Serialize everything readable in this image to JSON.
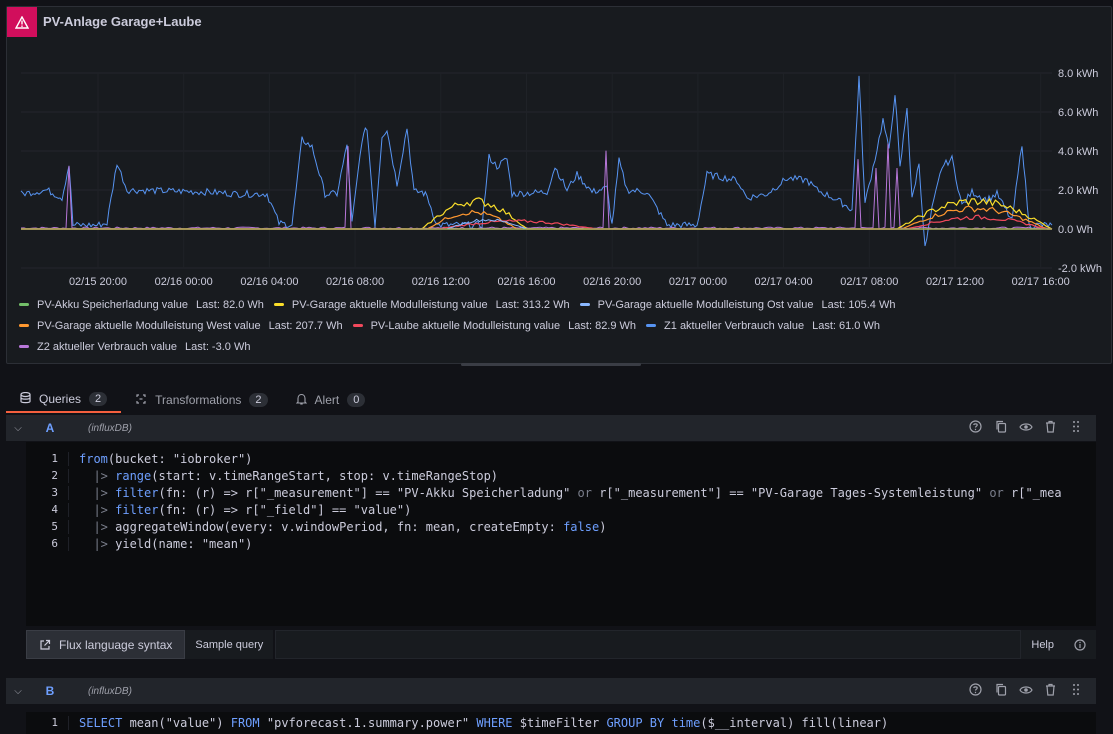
{
  "panel": {
    "title": "PV-Anlage Garage+Laube",
    "warning_icon": "warning-triangle-icon"
  },
  "chart_data": {
    "type": "line",
    "x": [
      "02/15 20:00",
      "02/16 00:00",
      "02/16 04:00",
      "02/16 08:00",
      "02/16 12:00",
      "02/16 16:00",
      "02/16 20:00",
      "02/17 00:00",
      "02/17 04:00",
      "02/17 08:00",
      "02/17 12:00",
      "02/17 16:00"
    ],
    "y_ticks": [
      "8.0 kWh",
      "6.0 kWh",
      "4.0 kWh",
      "2.0 kWh",
      "0.0 Wh",
      "-2.0 kWh"
    ],
    "ylim": [
      -2.0,
      8.0
    ],
    "series": [
      {
        "name": "PV-Akku Speicherladung value",
        "last": "Last: 82.0 Wh",
        "color": "#73bf69"
      },
      {
        "name": "PV-Garage aktuelle Modulleistung value",
        "last": "Last: 313.2 Wh",
        "color": "#fade2a"
      },
      {
        "name": "PV-Garage aktuelle Modulleistung Ost value",
        "last": "Last: 105.4 Wh",
        "color": "#8ab8ff"
      },
      {
        "name": "PV-Garage aktuelle Modulleistung West value",
        "last": "Last: 207.7 Wh",
        "color": "#ff9830"
      },
      {
        "name": "PV-Laube aktuelle Modulleistung value",
        "last": "Last: 82.9 Wh",
        "color": "#f2495c"
      },
      {
        "name": "Z1 aktueller Verbrauch value",
        "last": "Last: 61.0 Wh",
        "color": "#5794f2"
      },
      {
        "name": "Z2 aktueller Verbrauch value",
        "last": "Last: -3.0 Wh",
        "color": "#b877d9"
      }
    ]
  },
  "tabs": [
    {
      "label": "Queries",
      "count": "2",
      "icon": "database-icon"
    },
    {
      "label": "Transformations",
      "count": "2",
      "icon": "transform-icon"
    },
    {
      "label": "Alert",
      "count": "0",
      "icon": "bell-icon"
    }
  ],
  "queries": {
    "a": {
      "letter": "A",
      "datasource": "(influxDB)",
      "line_numbers": [
        "1",
        "2",
        "3",
        "4",
        "5",
        "6"
      ],
      "l1": {
        "kw": "from",
        "rest": "(bucket: \"iobroker\")"
      },
      "l2": {
        "pipe": "  |> ",
        "kw": "range",
        "rest": "(start: v.timeRangeStart, stop: v.timeRangeStop)"
      },
      "l3": {
        "pipe": "  |> ",
        "kw": "filter",
        "a": "(fn: (r) => r[\"_measurement\"] == \"PV-Akku Speicherladung\" ",
        "or1": "or",
        "b": " r[\"_measurement\"] == \"PV-Garage Tages-Systemleistung\" ",
        "or2": "or",
        "c": " r[\"_mea"
      },
      "l4": {
        "pipe": "  |> ",
        "kw": "filter",
        "rest": "(fn: (r) => r[\"_field\"] == \"value\")"
      },
      "l5": {
        "pipe": "  |> ",
        "a": "aggregateWindow(every: v.windowPeriod, fn: mean, createEmpty: ",
        "kw": "false",
        "b": ")"
      },
      "l6": {
        "pipe": "  |> ",
        "rest": "yield(name: \"mean\")"
      }
    },
    "b": {
      "letter": "B",
      "datasource": "(influxDB)",
      "line_number": "1",
      "l1": {
        "k1": "SELECT",
        "a": " mean(\"value\") ",
        "k2": "FROM",
        "b": " \"pvforecast.1.summary.power\" ",
        "k3": "WHERE",
        "c": " $timeFilter ",
        "k4": "GROUP BY",
        "d": " ",
        "k5": "time",
        "e": "($__interval) fill(linear)"
      }
    }
  },
  "editor_bar": {
    "flux_syntax": "Flux language syntax",
    "sample_query": "Sample query",
    "help": "Help"
  }
}
